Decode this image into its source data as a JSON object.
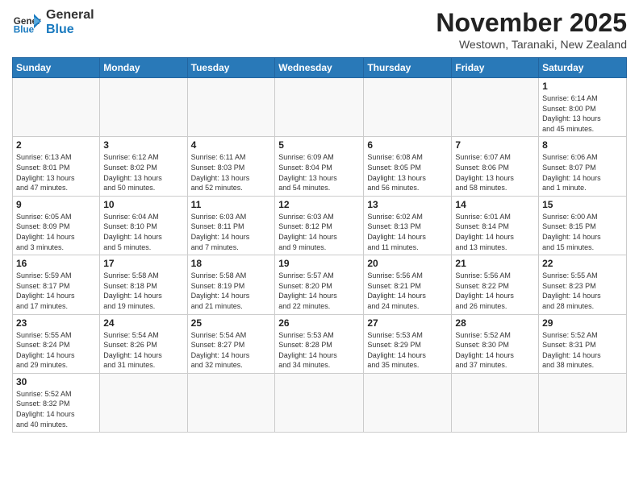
{
  "header": {
    "logo_line1": "General",
    "logo_line2": "Blue",
    "month_year": "November 2025",
    "location": "Westown, Taranaki, New Zealand"
  },
  "weekdays": [
    "Sunday",
    "Monday",
    "Tuesday",
    "Wednesday",
    "Thursday",
    "Friday",
    "Saturday"
  ],
  "weeks": [
    [
      {
        "day": "",
        "info": ""
      },
      {
        "day": "",
        "info": ""
      },
      {
        "day": "",
        "info": ""
      },
      {
        "day": "",
        "info": ""
      },
      {
        "day": "",
        "info": ""
      },
      {
        "day": "",
        "info": ""
      },
      {
        "day": "1",
        "info": "Sunrise: 6:14 AM\nSunset: 8:00 PM\nDaylight: 13 hours\nand 45 minutes."
      }
    ],
    [
      {
        "day": "2",
        "info": "Sunrise: 6:13 AM\nSunset: 8:01 PM\nDaylight: 13 hours\nand 47 minutes."
      },
      {
        "day": "3",
        "info": "Sunrise: 6:12 AM\nSunset: 8:02 PM\nDaylight: 13 hours\nand 50 minutes."
      },
      {
        "day": "4",
        "info": "Sunrise: 6:11 AM\nSunset: 8:03 PM\nDaylight: 13 hours\nand 52 minutes."
      },
      {
        "day": "5",
        "info": "Sunrise: 6:09 AM\nSunset: 8:04 PM\nDaylight: 13 hours\nand 54 minutes."
      },
      {
        "day": "6",
        "info": "Sunrise: 6:08 AM\nSunset: 8:05 PM\nDaylight: 13 hours\nand 56 minutes."
      },
      {
        "day": "7",
        "info": "Sunrise: 6:07 AM\nSunset: 8:06 PM\nDaylight: 13 hours\nand 58 minutes."
      },
      {
        "day": "8",
        "info": "Sunrise: 6:06 AM\nSunset: 8:07 PM\nDaylight: 14 hours\nand 1 minute."
      }
    ],
    [
      {
        "day": "9",
        "info": "Sunrise: 6:05 AM\nSunset: 8:09 PM\nDaylight: 14 hours\nand 3 minutes."
      },
      {
        "day": "10",
        "info": "Sunrise: 6:04 AM\nSunset: 8:10 PM\nDaylight: 14 hours\nand 5 minutes."
      },
      {
        "day": "11",
        "info": "Sunrise: 6:03 AM\nSunset: 8:11 PM\nDaylight: 14 hours\nand 7 minutes."
      },
      {
        "day": "12",
        "info": "Sunrise: 6:03 AM\nSunset: 8:12 PM\nDaylight: 14 hours\nand 9 minutes."
      },
      {
        "day": "13",
        "info": "Sunrise: 6:02 AM\nSunset: 8:13 PM\nDaylight: 14 hours\nand 11 minutes."
      },
      {
        "day": "14",
        "info": "Sunrise: 6:01 AM\nSunset: 8:14 PM\nDaylight: 14 hours\nand 13 minutes."
      },
      {
        "day": "15",
        "info": "Sunrise: 6:00 AM\nSunset: 8:15 PM\nDaylight: 14 hours\nand 15 minutes."
      }
    ],
    [
      {
        "day": "16",
        "info": "Sunrise: 5:59 AM\nSunset: 8:17 PM\nDaylight: 14 hours\nand 17 minutes."
      },
      {
        "day": "17",
        "info": "Sunrise: 5:58 AM\nSunset: 8:18 PM\nDaylight: 14 hours\nand 19 minutes."
      },
      {
        "day": "18",
        "info": "Sunrise: 5:58 AM\nSunset: 8:19 PM\nDaylight: 14 hours\nand 21 minutes."
      },
      {
        "day": "19",
        "info": "Sunrise: 5:57 AM\nSunset: 8:20 PM\nDaylight: 14 hours\nand 22 minutes."
      },
      {
        "day": "20",
        "info": "Sunrise: 5:56 AM\nSunset: 8:21 PM\nDaylight: 14 hours\nand 24 minutes."
      },
      {
        "day": "21",
        "info": "Sunrise: 5:56 AM\nSunset: 8:22 PM\nDaylight: 14 hours\nand 26 minutes."
      },
      {
        "day": "22",
        "info": "Sunrise: 5:55 AM\nSunset: 8:23 PM\nDaylight: 14 hours\nand 28 minutes."
      }
    ],
    [
      {
        "day": "23",
        "info": "Sunrise: 5:55 AM\nSunset: 8:24 PM\nDaylight: 14 hours\nand 29 minutes."
      },
      {
        "day": "24",
        "info": "Sunrise: 5:54 AM\nSunset: 8:26 PM\nDaylight: 14 hours\nand 31 minutes."
      },
      {
        "day": "25",
        "info": "Sunrise: 5:54 AM\nSunset: 8:27 PM\nDaylight: 14 hours\nand 32 minutes."
      },
      {
        "day": "26",
        "info": "Sunrise: 5:53 AM\nSunset: 8:28 PM\nDaylight: 14 hours\nand 34 minutes."
      },
      {
        "day": "27",
        "info": "Sunrise: 5:53 AM\nSunset: 8:29 PM\nDaylight: 14 hours\nand 35 minutes."
      },
      {
        "day": "28",
        "info": "Sunrise: 5:52 AM\nSunset: 8:30 PM\nDaylight: 14 hours\nand 37 minutes."
      },
      {
        "day": "29",
        "info": "Sunrise: 5:52 AM\nSunset: 8:31 PM\nDaylight: 14 hours\nand 38 minutes."
      }
    ],
    [
      {
        "day": "30",
        "info": "Sunrise: 5:52 AM\nSunset: 8:32 PM\nDaylight: 14 hours\nand 40 minutes."
      },
      {
        "day": "",
        "info": ""
      },
      {
        "day": "",
        "info": ""
      },
      {
        "day": "",
        "info": ""
      },
      {
        "day": "",
        "info": ""
      },
      {
        "day": "",
        "info": ""
      },
      {
        "day": "",
        "info": ""
      }
    ]
  ]
}
